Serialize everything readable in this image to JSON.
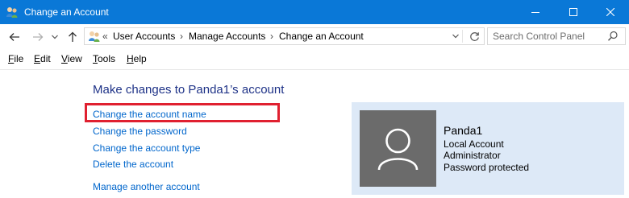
{
  "window": {
    "title": "Change an Account",
    "accent": "#0a78d7"
  },
  "address_bar": {
    "overflow_chevron": "«",
    "crumbs": [
      "User Accounts",
      "Manage Accounts",
      "Change an Account"
    ],
    "separator": "›"
  },
  "search": {
    "placeholder": "Search Control Panel"
  },
  "menu": {
    "file": {
      "key": "F",
      "rest": "ile"
    },
    "edit": {
      "key": "E",
      "rest": "dit"
    },
    "view": {
      "key": "V",
      "rest": "iew"
    },
    "tools": {
      "key": "T",
      "rest": "ools"
    },
    "help": {
      "key": "H",
      "rest": "elp"
    }
  },
  "content": {
    "heading": "Make changes to Panda1’s account",
    "links": {
      "change_name": "Change the account name",
      "change_password": "Change the password",
      "change_type": "Change the account type",
      "delete": "Delete the account",
      "manage_another": "Manage another account"
    },
    "highlight_color": "#e02030",
    "link_color": "#0066cc"
  },
  "account": {
    "name": "Panda1",
    "type": "Local Account",
    "role": "Administrator",
    "status": "Password protected",
    "panel_color": "#dde9f7",
    "avatar_color": "#6b6b6b"
  }
}
